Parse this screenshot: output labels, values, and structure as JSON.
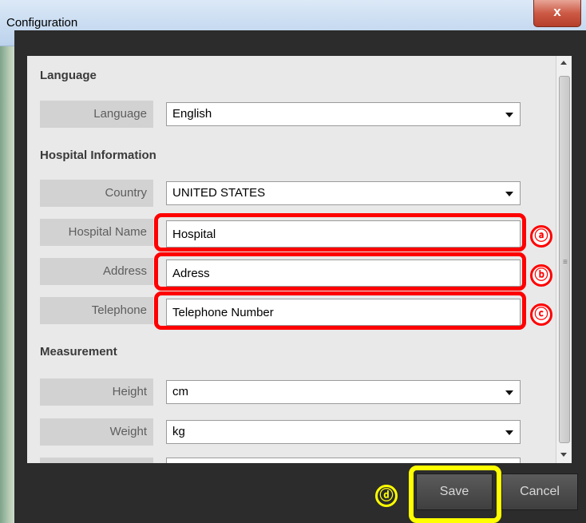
{
  "window": {
    "title": "Configuration",
    "close_label": "x"
  },
  "sections": {
    "language": "Language",
    "hospital": "Hospital Information",
    "measurement": "Measurement"
  },
  "fields": {
    "language": {
      "label": "Language",
      "value": "English"
    },
    "country": {
      "label": "Country",
      "value": "UNITED STATES"
    },
    "hospital_name": {
      "label": "Hospital Name",
      "value": "Hospital"
    },
    "address": {
      "label": "Address",
      "value": "Adress"
    },
    "telephone": {
      "label": "Telephone",
      "value": "Telephone Number"
    },
    "height": {
      "label": "Height",
      "value": "cm"
    },
    "weight": {
      "label": "Weight",
      "value": "kg"
    }
  },
  "buttons": {
    "save": "Save",
    "cancel": "Cancel"
  },
  "annotations": {
    "a": "ⓐ",
    "b": "ⓑ",
    "c": "ⓒ",
    "d": "ⓓ"
  },
  "colors": {
    "highlight_red": "#ff0000",
    "highlight_yellow": "#ffff00",
    "frame": "#2c2c2c",
    "panel": "#e9e9e9"
  }
}
